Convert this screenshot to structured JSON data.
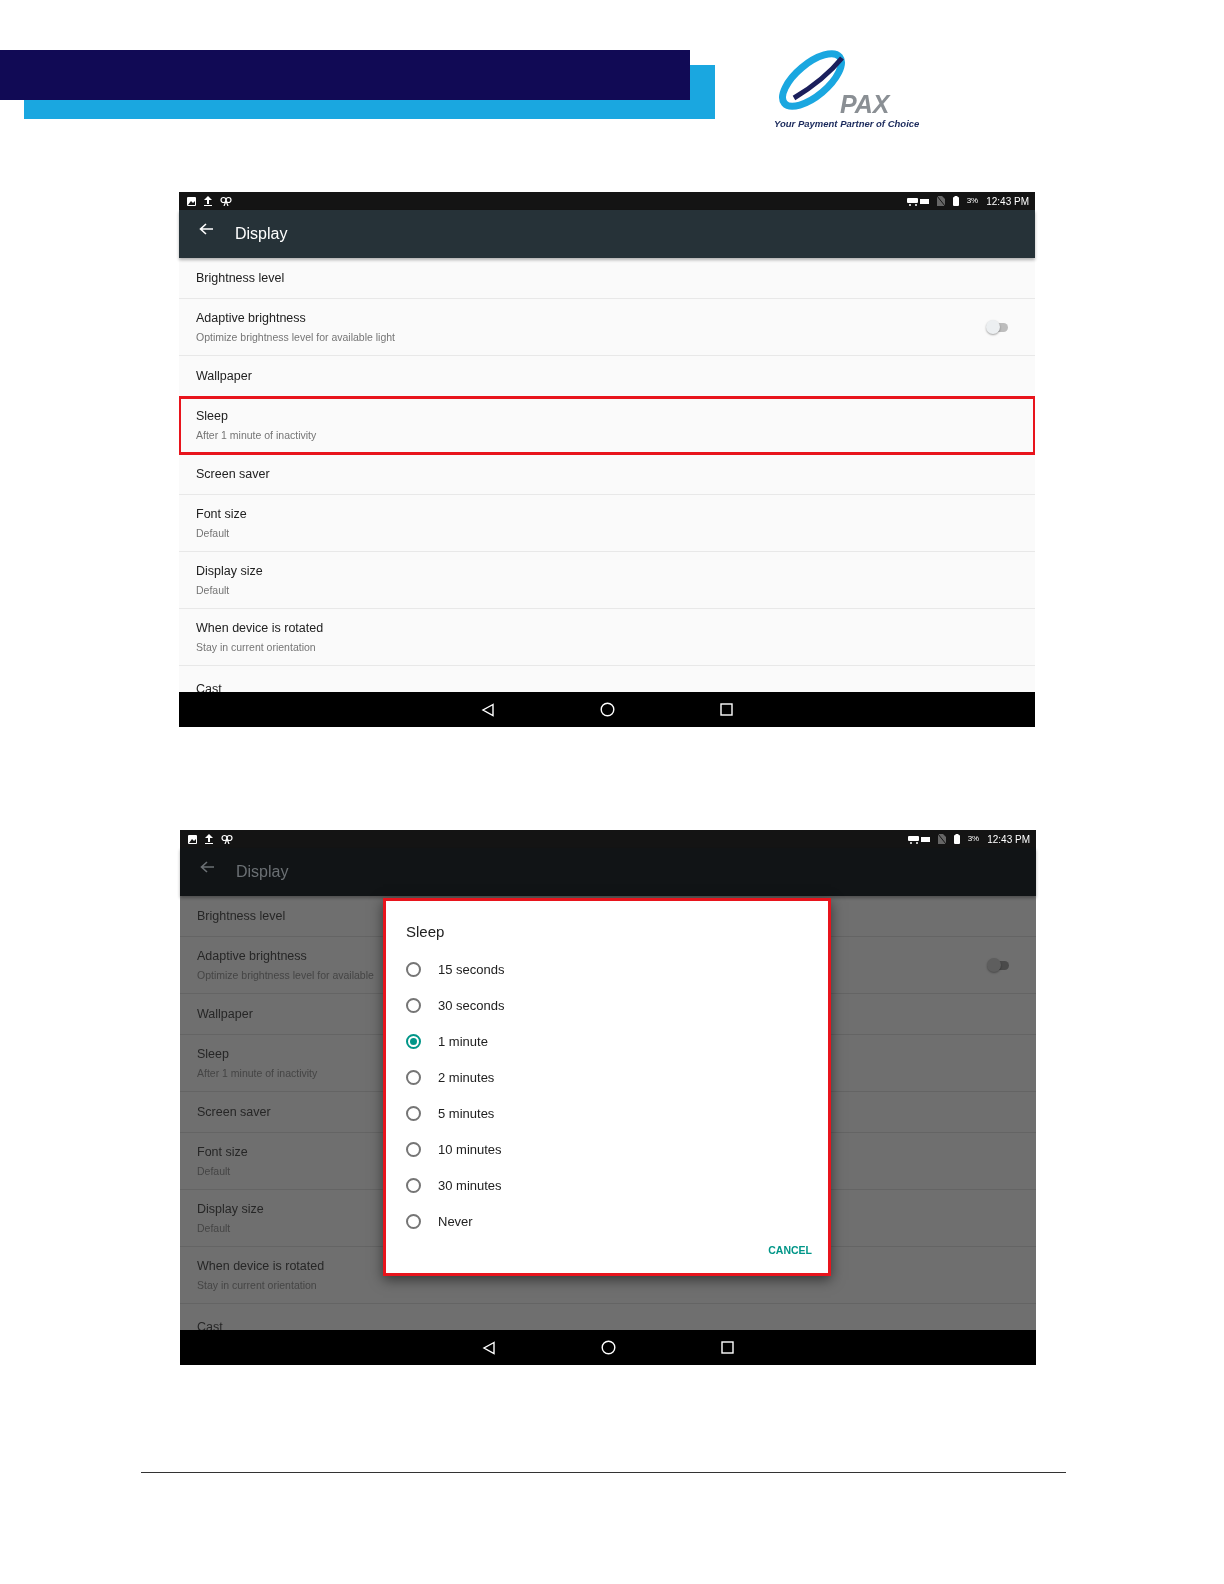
{
  "header": {
    "logo": {
      "brand": "PAX",
      "tagline": "Your Payment Partner of Choice"
    }
  },
  "screens": [
    {
      "dimmed": false,
      "status_bar": {
        "battery": "3%",
        "time": "12:43 PM"
      },
      "toolbar": {
        "title": "Display"
      },
      "settings": [
        {
          "title": "Brightness level",
          "highlighted": false
        },
        {
          "title": "Adaptive brightness",
          "subtitle": "Optimize brightness level for available light",
          "kind": "toggle",
          "on": false,
          "highlighted": false
        },
        {
          "title": "Wallpaper",
          "highlighted": false
        },
        {
          "title": "Sleep",
          "subtitle": "After 1 minute of inactivity",
          "highlighted": true
        },
        {
          "title": "Screen saver",
          "highlighted": false
        },
        {
          "title": "Font size",
          "subtitle": "Default",
          "highlighted": false
        },
        {
          "title": "Display size",
          "subtitle": "Default",
          "highlighted": false
        },
        {
          "title": "When device is rotated",
          "subtitle": "Stay in current orientation",
          "highlighted": false
        },
        {
          "title": "Cast",
          "highlighted": false
        }
      ]
    },
    {
      "dimmed": true,
      "status_bar": {
        "battery": "3%",
        "time": "12:43 PM"
      },
      "toolbar": {
        "title": "Display"
      },
      "settings": [
        {
          "title": "Brightness level",
          "highlighted": false
        },
        {
          "title": "Adaptive brightness",
          "subtitle": "Optimize brightness level for available",
          "kind": "toggle",
          "on": false,
          "highlighted": false
        },
        {
          "title": "Wallpaper",
          "highlighted": false
        },
        {
          "title": "Sleep",
          "subtitle": "After 1 minute of inactivity",
          "highlighted": false
        },
        {
          "title": "Screen saver",
          "highlighted": false
        },
        {
          "title": "Font size",
          "subtitle": "Default",
          "highlighted": false
        },
        {
          "title": "Display size",
          "subtitle": "Default",
          "highlighted": false
        },
        {
          "title": "When device is rotated",
          "subtitle": "Stay in current orientation",
          "highlighted": false
        },
        {
          "title": "Cast",
          "highlighted": false
        }
      ],
      "dialog": {
        "title": "Sleep",
        "highlighted": true,
        "options": [
          {
            "label": "15 seconds",
            "selected": false
          },
          {
            "label": "30 seconds",
            "selected": false
          },
          {
            "label": "1 minute",
            "selected": true
          },
          {
            "label": "2 minutes",
            "selected": false
          },
          {
            "label": "5 minutes",
            "selected": false
          },
          {
            "label": "10 minutes",
            "selected": false
          },
          {
            "label": "30 minutes",
            "selected": false
          },
          {
            "label": "Never",
            "selected": false
          }
        ],
        "cancel": "CANCEL"
      }
    }
  ]
}
